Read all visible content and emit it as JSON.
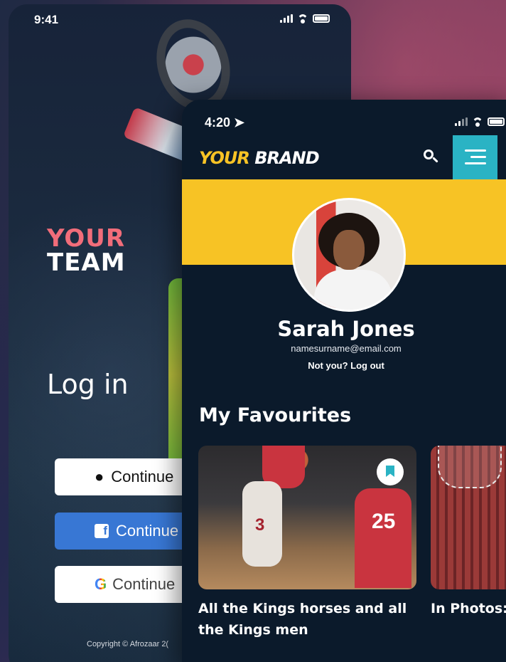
{
  "back_screen": {
    "status": {
      "time": "9:41"
    },
    "brand_line1": "YOUR",
    "brand_line2": "TEAM",
    "login_title": "Log in",
    "buttons": {
      "apple": "Continue",
      "facebook": "Continue w",
      "google": "Continue"
    },
    "google_letter": "G",
    "facebook_letter": "f",
    "apple_glyph": "",
    "copyright": "Copyright © Afrozaar 2("
  },
  "front_screen": {
    "status": {
      "time": "4:20 ➤"
    },
    "logo": {
      "part1": "YOUR",
      "part2": "BRAND"
    },
    "user": {
      "name": "Sarah Jones",
      "email": "namesurname@email.com",
      "logout": "Not you? Log out"
    },
    "favourites_title": "My Favourites",
    "favourites": [
      {
        "title": "All the Kings horses and all the Kings men",
        "jersey_a": "3",
        "jersey_b": "25"
      },
      {
        "title": "In Photos: F Underway"
      }
    ]
  },
  "colors": {
    "brand_yellow": "#f7c325",
    "accent_teal": "#2ab3c4",
    "team_coral": "#f26d7a",
    "facebook_blue": "#3877d4",
    "app_bg": "#0b1a2b"
  },
  "icons": [
    "apple-icon",
    "facebook-icon",
    "google-icon",
    "search-icon",
    "menu-icon",
    "bookmark-icon",
    "location-arrow-icon",
    "signal-icon",
    "wifi-icon",
    "battery-icon"
  ]
}
